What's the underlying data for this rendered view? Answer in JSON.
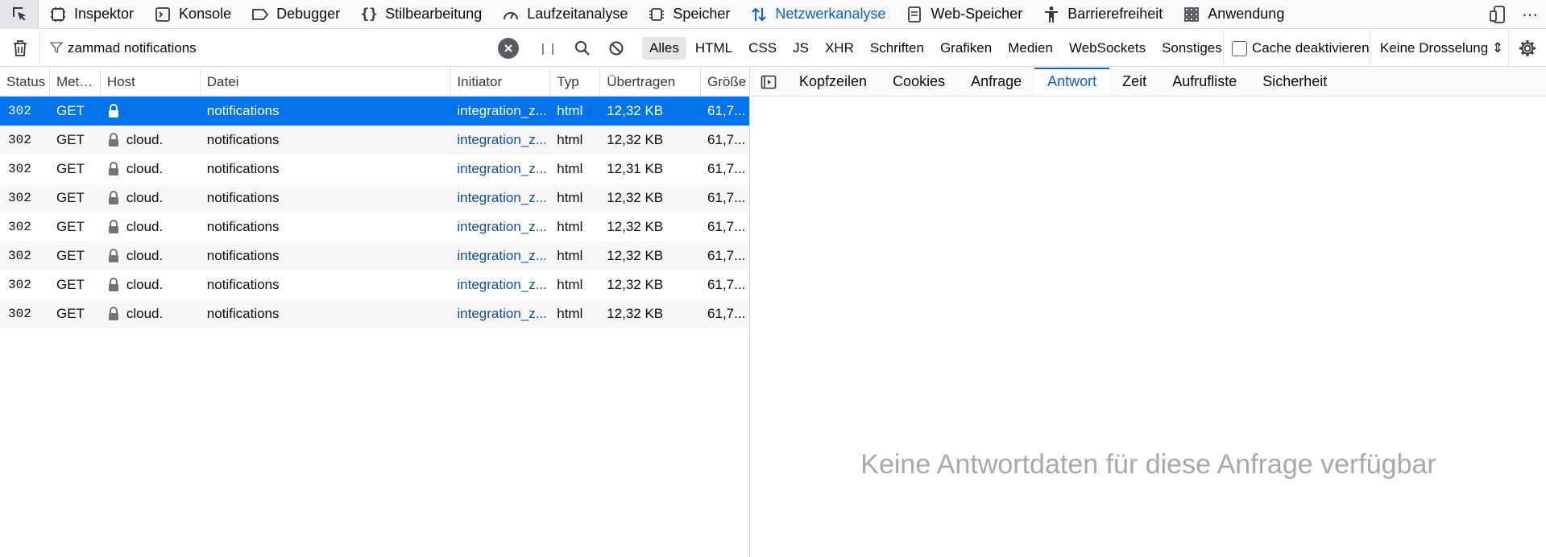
{
  "toolbox": {
    "tabs": [
      {
        "label": "Inspektor",
        "icon": "inspector-icon"
      },
      {
        "label": "Konsole",
        "icon": "console-icon"
      },
      {
        "label": "Debugger",
        "icon": "debugger-icon"
      },
      {
        "label": "Stilbearbeitung",
        "icon": "style-editor-icon"
      },
      {
        "label": "Laufzeitanalyse",
        "icon": "performance-icon"
      },
      {
        "label": "Speicher",
        "icon": "memory-icon"
      },
      {
        "label": "Netzwerkanalyse",
        "icon": "network-icon",
        "active": true
      },
      {
        "label": "Web-Speicher",
        "icon": "storage-icon"
      },
      {
        "label": "Barrierefreiheit",
        "icon": "accessibility-icon"
      },
      {
        "label": "Anwendung",
        "icon": "application-icon"
      }
    ],
    "more_label": "⋯",
    "accent_color": "#0a62d6"
  },
  "filterbar": {
    "filter_value": "zammad notifications",
    "pause_label": "| |",
    "chips": [
      "Alles",
      "HTML",
      "CSS",
      "JS",
      "XHR",
      "Schriften",
      "Grafiken",
      "Medien",
      "WebSockets",
      "Sonstiges"
    ],
    "active_chip": "Alles",
    "cache_label": "Cache deaktivieren",
    "throttle_label": "Keine Drosselung ⇕"
  },
  "table": {
    "columns": [
      "Status",
      "Met…",
      "Host",
      "Datei",
      "Initiator",
      "Typ",
      "Übertragen",
      "Größe"
    ],
    "rows": [
      {
        "status": "302",
        "method": "GET",
        "host": "",
        "file": "notifications",
        "initiator": "integration_z...",
        "type": "html",
        "transferred": "12,32 KB",
        "size": "61,7..."
      },
      {
        "status": "302",
        "method": "GET",
        "host": "cloud.",
        "file": "notifications",
        "initiator": "integration_z...",
        "type": "html",
        "transferred": "12,32 KB",
        "size": "61,7..."
      },
      {
        "status": "302",
        "method": "GET",
        "host": "cloud.",
        "file": "notifications",
        "initiator": "integration_z...",
        "type": "html",
        "transferred": "12,31 KB",
        "size": "61,7..."
      },
      {
        "status": "302",
        "method": "GET",
        "host": "cloud.",
        "file": "notifications",
        "initiator": "integration_z...",
        "type": "html",
        "transferred": "12,32 KB",
        "size": "61,7..."
      },
      {
        "status": "302",
        "method": "GET",
        "host": "cloud.",
        "file": "notifications",
        "initiator": "integration_z...",
        "type": "html",
        "transferred": "12,32 KB",
        "size": "61,7..."
      },
      {
        "status": "302",
        "method": "GET",
        "host": "cloud.",
        "file": "notifications",
        "initiator": "integration_z...",
        "type": "html",
        "transferred": "12,32 KB",
        "size": "61,7..."
      },
      {
        "status": "302",
        "method": "GET",
        "host": "cloud.",
        "file": "notifications",
        "initiator": "integration_z...",
        "type": "html",
        "transferred": "12,32 KB",
        "size": "61,7..."
      },
      {
        "status": "302",
        "method": "GET",
        "host": "cloud.",
        "file": "notifications",
        "initiator": "integration_z...",
        "type": "html",
        "transferred": "12,32 KB",
        "size": "61,7..."
      }
    ],
    "selected_color": "#0074e8"
  },
  "details": {
    "tabs": [
      "Kopfzeilen",
      "Cookies",
      "Anfrage",
      "Antwort",
      "Zeit",
      "Aufrufliste",
      "Sicherheit"
    ],
    "active_tab": "Antwort",
    "empty_message": "Keine Antwortdaten für diese Anfrage verfügbar"
  }
}
